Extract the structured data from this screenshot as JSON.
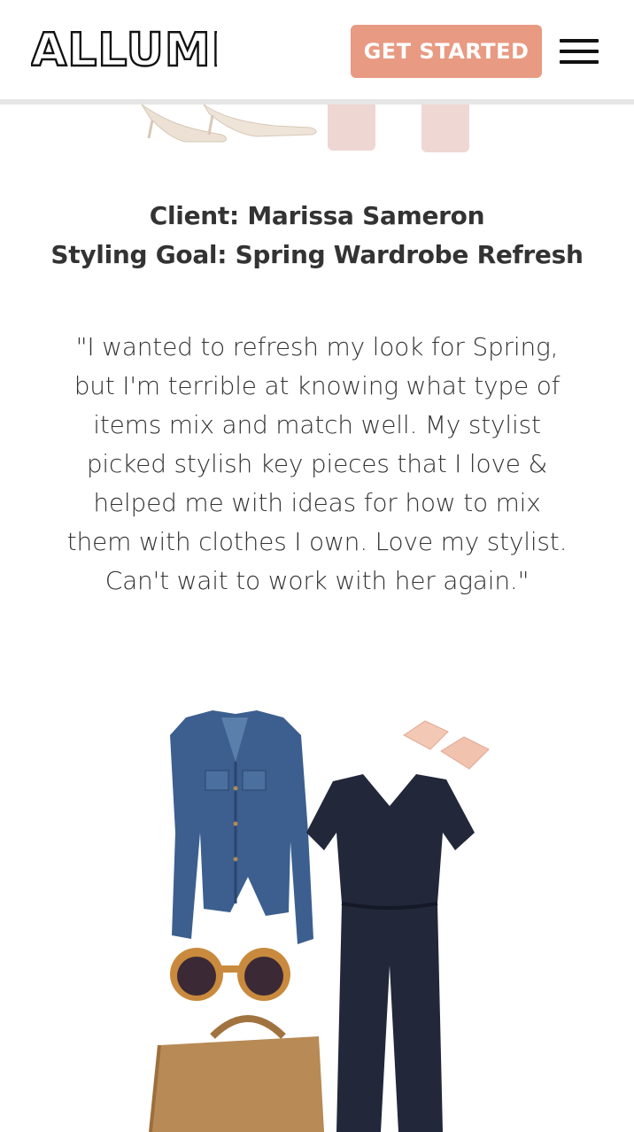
{
  "brand": {
    "logo_text": "ALLUME"
  },
  "header": {
    "cta_label": "GET STARTED",
    "menu_icon": "hamburger-menu-icon"
  },
  "testimonial": {
    "client_line": "Client: Marissa Sameron",
    "goal_line": "Styling Goal: Spring Wardrobe Refresh",
    "quote_lines": [
      "\"I wanted to refresh my look for Spring,",
      "but I'm terrible at knowing what type of",
      "items mix and match well. My stylist",
      "picked stylish key pieces that I love &",
      "helped me with ideas for how to mix",
      "them with clothes I own. Love my stylist.",
      "Can't wait to work with her again.\""
    ]
  },
  "colors": {
    "accent": "#e89a82",
    "text": "#333333",
    "denim": "#3c5f8f",
    "jumpsuit": "#23273a"
  }
}
